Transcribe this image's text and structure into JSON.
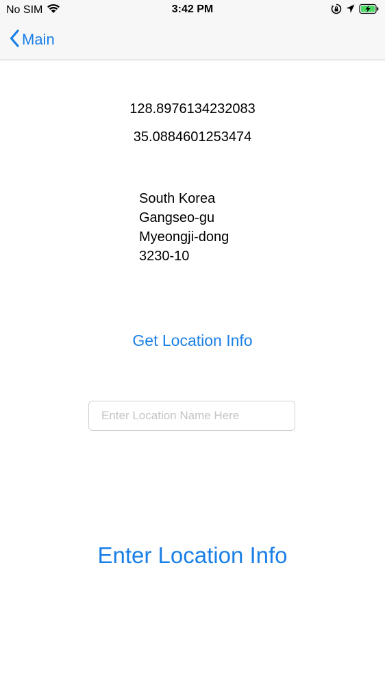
{
  "status_bar": {
    "carrier": "No SIM",
    "time": "3:42 PM",
    "icons": [
      "wifi-icon",
      "orientation-lock-icon",
      "location-arrow-icon",
      "battery-charging-icon"
    ]
  },
  "nav": {
    "back_label": "Main",
    "back_icon": "chevron-left-icon",
    "accent_color": "#1a7fe6"
  },
  "coordinates": {
    "longitude": "128.8976134232083",
    "latitude": "35.0884601253474"
  },
  "address": {
    "country": "South Korea",
    "district": "Gangseo-gu",
    "neighborhood": "Myeongji-dong",
    "number": "3230-10"
  },
  "actions": {
    "get_location_label": "Get Location Info",
    "enter_location_label": "Enter Location Info"
  },
  "location_input": {
    "value": "",
    "placeholder": "Enter Location Name Here"
  }
}
